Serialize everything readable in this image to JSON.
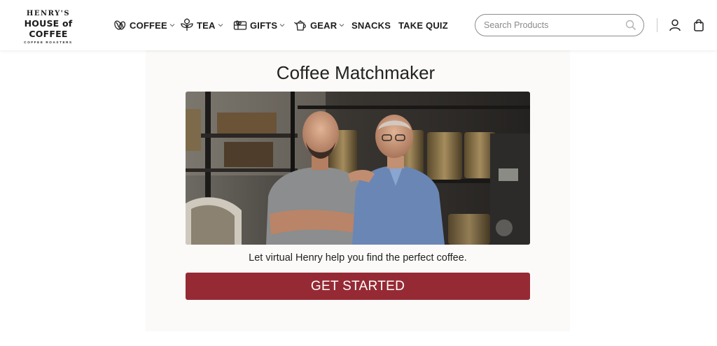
{
  "header": {
    "logo": {
      "line1": "HENRY'S",
      "line2": "HOUSE of COFFEE",
      "line3": "COFFEE ROASTERS"
    },
    "nav": [
      {
        "label": "COFFEE",
        "icon": "coffee-bean-icon",
        "dropdown": true
      },
      {
        "label": "TEA",
        "icon": "tea-leaf-icon",
        "dropdown": true
      },
      {
        "label": "GIFTS",
        "icon": "gift-card-icon",
        "dropdown": true
      },
      {
        "label": "GEAR",
        "icon": "kettle-icon",
        "dropdown": true
      },
      {
        "label": "SNACKS",
        "dropdown": false
      },
      {
        "label": "TAKE QUIZ",
        "dropdown": false
      }
    ],
    "search": {
      "placeholder": "Search Products",
      "value": ""
    },
    "icons": [
      "account-icon",
      "shopping-bag-icon"
    ]
  },
  "main": {
    "title": "Coffee Matchmaker",
    "image": "photo-of-two-smiling-men-in-coffee-roastery",
    "tagline": "Let virtual Henry help you find the perfect coffee.",
    "cta_label": "GET STARTED"
  },
  "colors": {
    "accent": "#952a35",
    "card_bg": "#fbfaf8",
    "text": "#1c1c1c"
  }
}
